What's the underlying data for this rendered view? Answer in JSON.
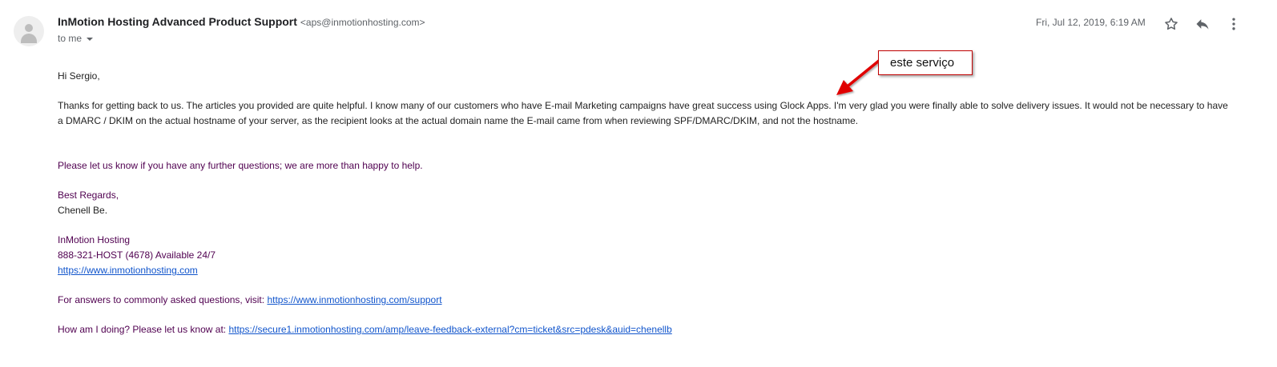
{
  "sender": {
    "name": "InMotion Hosting Advanced Product Support",
    "email": "<aps@inmotionhosting.com>"
  },
  "recipient": {
    "label": "to me"
  },
  "date": "Fri, Jul 12, 2019, 6:19 AM",
  "icons": {
    "avatar": "default-avatar-icon",
    "star": "star-icon",
    "reply": "reply-icon",
    "more": "more-vert-icon",
    "caret": "chevron-down-icon"
  },
  "body": {
    "greeting": "Hi Sergio,",
    "paragraph1": "Thanks for getting back to us. The articles you provided are quite helpful. I know many of our customers who have E-mail Marketing campaigns have great success using Glock Apps. I'm very glad you were finally able to solve delivery issues. It would not be necessary to have a DMARC / DKIM on the actual hostname of your server, as the recipient looks at the actual domain name the E-mail came from when reviewing SPF/DMARC/DKIM, and not the hostname.",
    "paragraph2": "Please let us know if you have any further questions; we are more than happy to help.",
    "closing": "Best Regards,",
    "signature_name": "Chenell Be.",
    "company": "InMotion Hosting",
    "phone": "888-321-HOST (4678) Available 24/7",
    "website": "https://www.inmotionhosting.com",
    "faq_prefix": "For answers to commonly asked questions, visit: ",
    "faq_link": "https://www.inmotionhosting.com/support",
    "feedback_prefix": "How am I doing? Please let us know at: ",
    "feedback_link": "https://secure1.inmotionhosting.com/amp/leave-feedback-external?cm=ticket&src=pdesk&auid=chenellb"
  },
  "annotation": {
    "label": "este serviço"
  },
  "colors": {
    "quoted_text": "#500050",
    "link": "#1155cc",
    "annotation_border": "#c00000",
    "annotation_arrow": "#e00000"
  }
}
